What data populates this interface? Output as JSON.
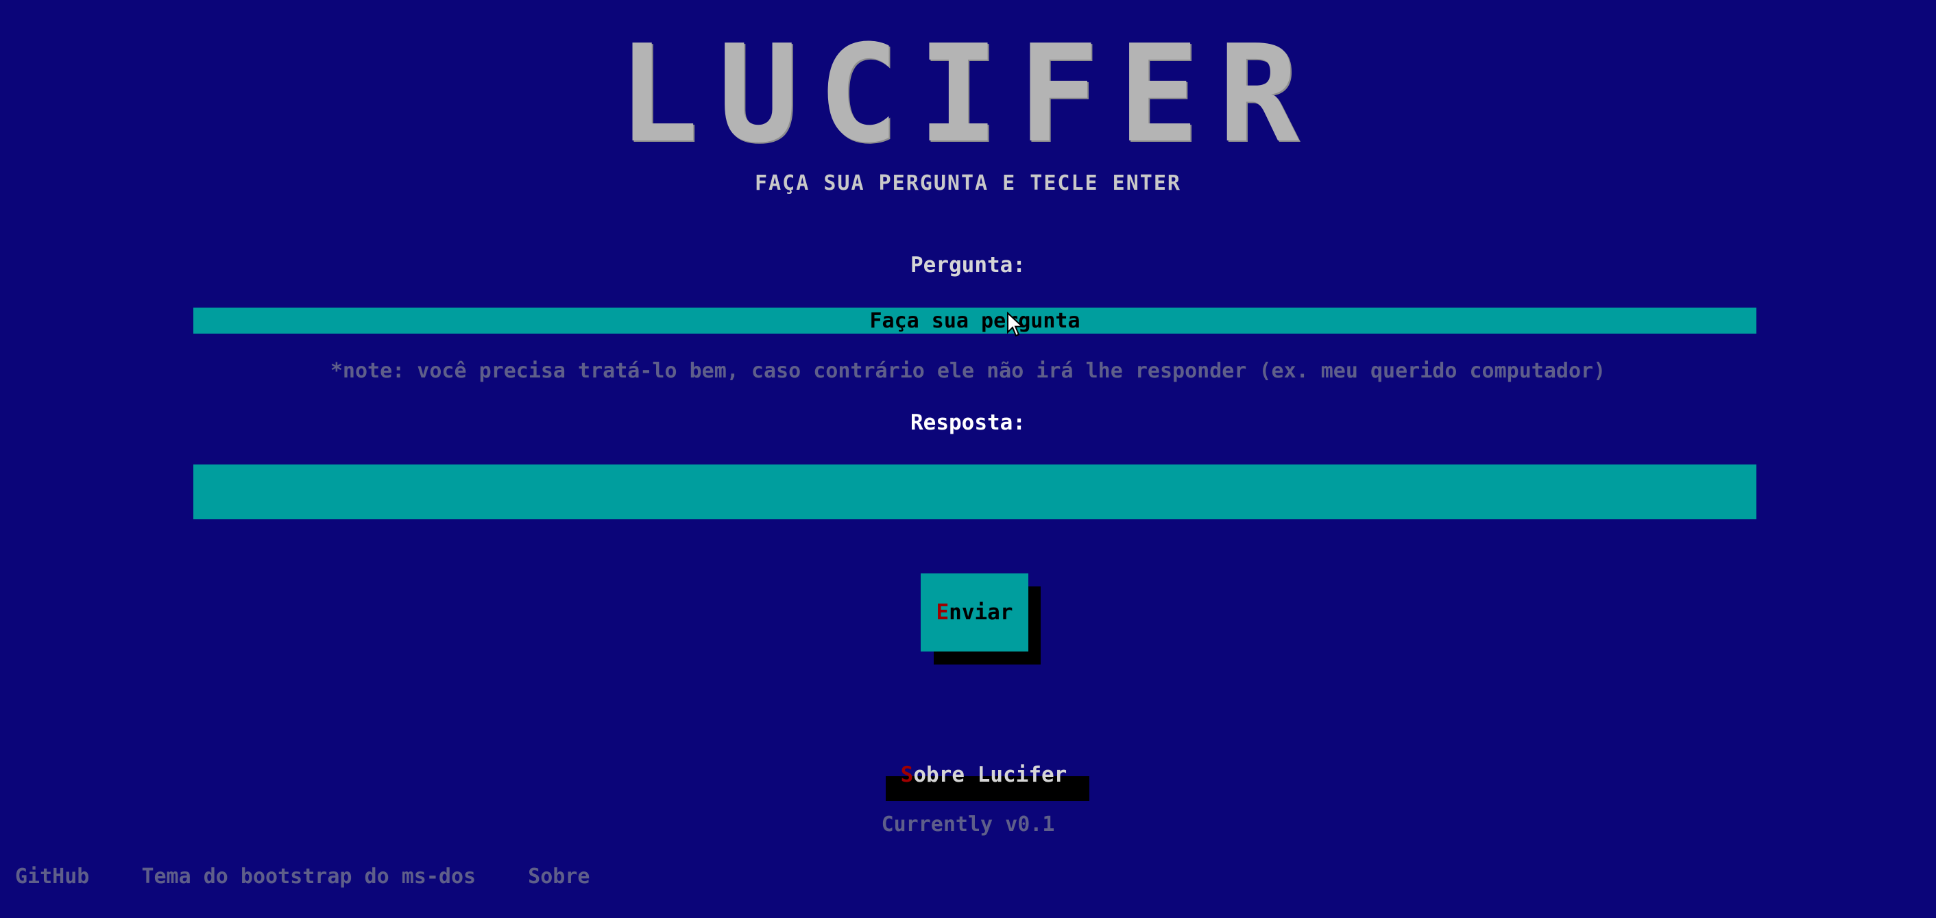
{
  "header": {
    "logo": "LUCIFER",
    "subtitle": "FAÇA SUA PERGUNTA E TECLE ENTER"
  },
  "question": {
    "label": "Pergunta:",
    "placeholder": "Faça sua pergunta",
    "value": ""
  },
  "note": "*note: você precisa tratá-lo bem, caso contrário ele não irá lhe responder (ex. meu querido computador)",
  "answer": {
    "label": "Resposta:",
    "value": ""
  },
  "send_button": {
    "hotkey": "E",
    "rest": "nviar"
  },
  "about_link": {
    "hotkey": "S",
    "rest": "obre Lucifer"
  },
  "version": "Currently v0.1",
  "footer": {
    "links": [
      "GitHub",
      "Tema do bootstrap do ms-dos",
      "Sobre"
    ]
  },
  "colors": {
    "background": "#0b0579",
    "input": "#009e9e",
    "hotkey": "#a00000",
    "muted_text": "#5f5f8a",
    "logo": "#b4b4b4"
  }
}
